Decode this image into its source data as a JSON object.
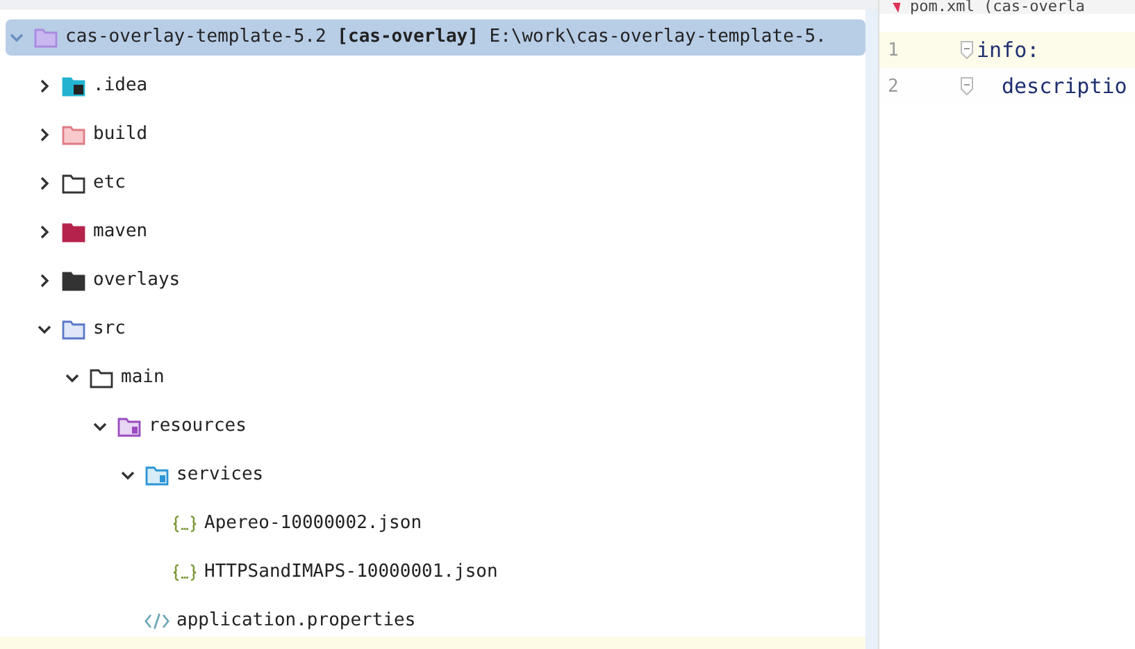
{
  "project_tree": {
    "root": {
      "label": "cas-overlay-template-5.2 **[cas-overlay]** E:\\work\\cas-overlay-template-5.",
      "kind": "project",
      "expanded": true,
      "selected": true,
      "children": [
        {
          "label": ".idea",
          "kind": "idea",
          "expanded": false,
          "selected": false
        },
        {
          "label": "build",
          "kind": "excluded",
          "expanded": false,
          "selected": false
        },
        {
          "label": "etc",
          "kind": "folder",
          "expanded": false,
          "selected": false
        },
        {
          "label": "maven",
          "kind": "maven",
          "expanded": false,
          "selected": false
        },
        {
          "label": "overlays",
          "kind": "dark",
          "expanded": false,
          "selected": false
        },
        {
          "label": "src",
          "kind": "source",
          "expanded": true,
          "selected": false,
          "children": [
            {
              "label": "main",
              "kind": "folder",
              "expanded": true,
              "selected": false,
              "children": [
                {
                  "label": "resources",
                  "kind": "resources",
                  "expanded": true,
                  "selected": false,
                  "children": [
                    {
                      "label": "services",
                      "kind": "package",
                      "expanded": true,
                      "selected": false,
                      "children": [
                        {
                          "label": "Apereo-10000002.json",
                          "kind": "json",
                          "selected": false
                        },
                        {
                          "label": "HTTPSandIMAPS-10000001.json",
                          "kind": "json",
                          "selected": false
                        }
                      ]
                    },
                    {
                      "label": "application.properties",
                      "kind": "properties",
                      "selected": false
                    }
                  ]
                }
              ]
            }
          ]
        }
      ]
    }
  },
  "editor": {
    "tab": "pom.xml (cas-overla",
    "lines": [
      {
        "number": "1",
        "key": "info:",
        "current": true
      },
      {
        "number": "2",
        "key": "descriptio",
        "current": false
      }
    ]
  }
}
